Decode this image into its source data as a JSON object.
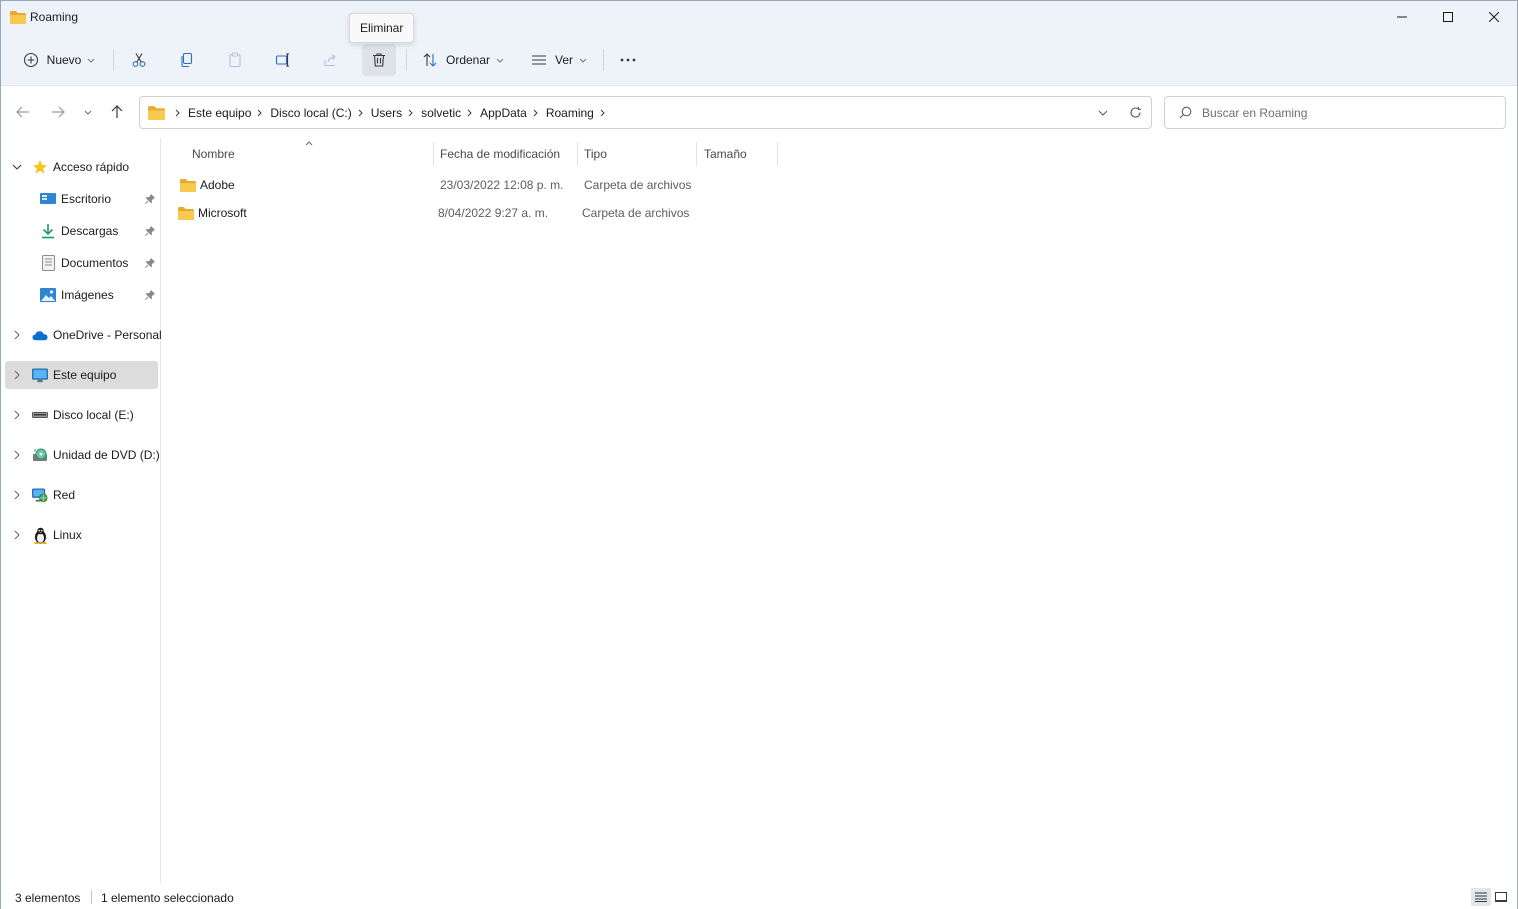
{
  "window": {
    "title": "Roaming",
    "controls": {
      "minimize": "minimize-icon",
      "maximize": "maximize-icon",
      "close": "close-icon"
    }
  },
  "commandbar": {
    "new_label": "Nuevo",
    "sort_label": "Ordenar",
    "view_label": "Ver",
    "tooltip": "Eliminar",
    "icons": [
      "plus-circle-icon",
      "cut-icon",
      "copy-icon",
      "paste-icon",
      "rename-icon",
      "share-icon",
      "delete-icon",
      "sort-icon",
      "view-icon",
      "more-icon"
    ]
  },
  "address": {
    "crumbs": [
      "Este equipo",
      "Disco local (C:)",
      "Users",
      "solvetic",
      "AppData",
      "Roaming"
    ]
  },
  "search": {
    "placeholder": "Buscar en Roaming"
  },
  "sidebar": {
    "items": [
      {
        "label": "Acceso rápido",
        "icon": "star-icon"
      },
      {
        "label": "Escritorio",
        "icon": "desktop-icon"
      },
      {
        "label": "Descargas",
        "icon": "download-icon"
      },
      {
        "label": "Documentos",
        "icon": "document-icon"
      },
      {
        "label": "Imágenes",
        "icon": "image-icon"
      },
      {
        "label": "OneDrive - Personal",
        "icon": "cloud-icon"
      },
      {
        "label": "Este equipo",
        "icon": "computer-icon"
      },
      {
        "label": "Disco local (E:)",
        "icon": "drive-icon"
      },
      {
        "label": "Unidad de DVD (D:)",
        "icon": "dvd-icon"
      },
      {
        "label": "Red",
        "icon": "network-icon"
      },
      {
        "label": "Linux",
        "icon": "linux-icon"
      }
    ]
  },
  "filelist": {
    "columns": [
      "Nombre",
      "Fecha de modificación",
      "Tipo",
      "Tamaño"
    ],
    "rows": [
      {
        "name": "Adobe",
        "date": "23/03/2022 12:08 p. m.",
        "type": "Carpeta de archivos",
        "size": ""
      },
      {
        "name": "Microsoft",
        "date": "8/04/2022 9:27 a. m.",
        "type": "Carpeta de archivos",
        "size": ""
      }
    ]
  },
  "status": {
    "count": "3 elementos",
    "selection": "1 elemento seleccionado"
  },
  "colors": {
    "chrome_bg": "#eef3f9",
    "folder_yellow": "#f5c14b",
    "accent_blue": "#0067c0",
    "selected_bg": "#dcdcdc"
  }
}
